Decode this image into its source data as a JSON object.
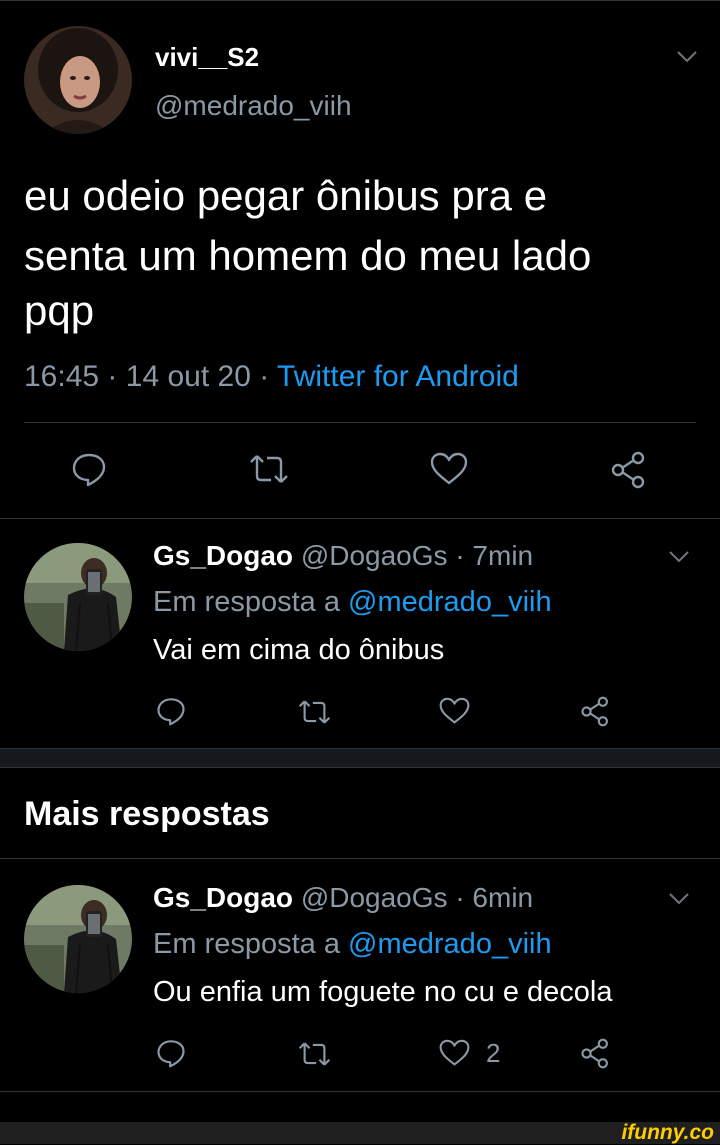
{
  "main_tweet": {
    "display_name": "vivi__S2",
    "handle": "@medrado_viih",
    "text_line1": "eu odeio pegar ônibus pra e",
    "text_line2": "senta um homem do meu lado",
    "text_line3": "pqp",
    "time": "16:45",
    "date": "14 out 20",
    "source": "Twitter for Android"
  },
  "replies": [
    {
      "display_name": "Gs_Dogao",
      "handle": "@DogaoGs",
      "age": "7min",
      "reply_prefix": "Em resposta a",
      "reply_to": "@medrado_viih",
      "text": "Vai em cima do ônibus",
      "like_count": ""
    },
    {
      "display_name": "Gs_Dogao",
      "handle": "@DogaoGs",
      "age": "6min",
      "reply_prefix": "Em resposta a",
      "reply_to": "@medrado_viih",
      "text": "Ou enfia um foguete no cu e decola",
      "like_count": "2"
    }
  ],
  "section_heading": "Mais respostas",
  "watermark": "ifunny.co",
  "icons": [
    "chevron-down-icon",
    "reply-icon",
    "retweet-icon",
    "like-icon",
    "share-icon"
  ],
  "colors": {
    "background": "#000000",
    "link": "#1d9bf0",
    "secondary": "#8b98a5",
    "divider": "#2f3336"
  }
}
